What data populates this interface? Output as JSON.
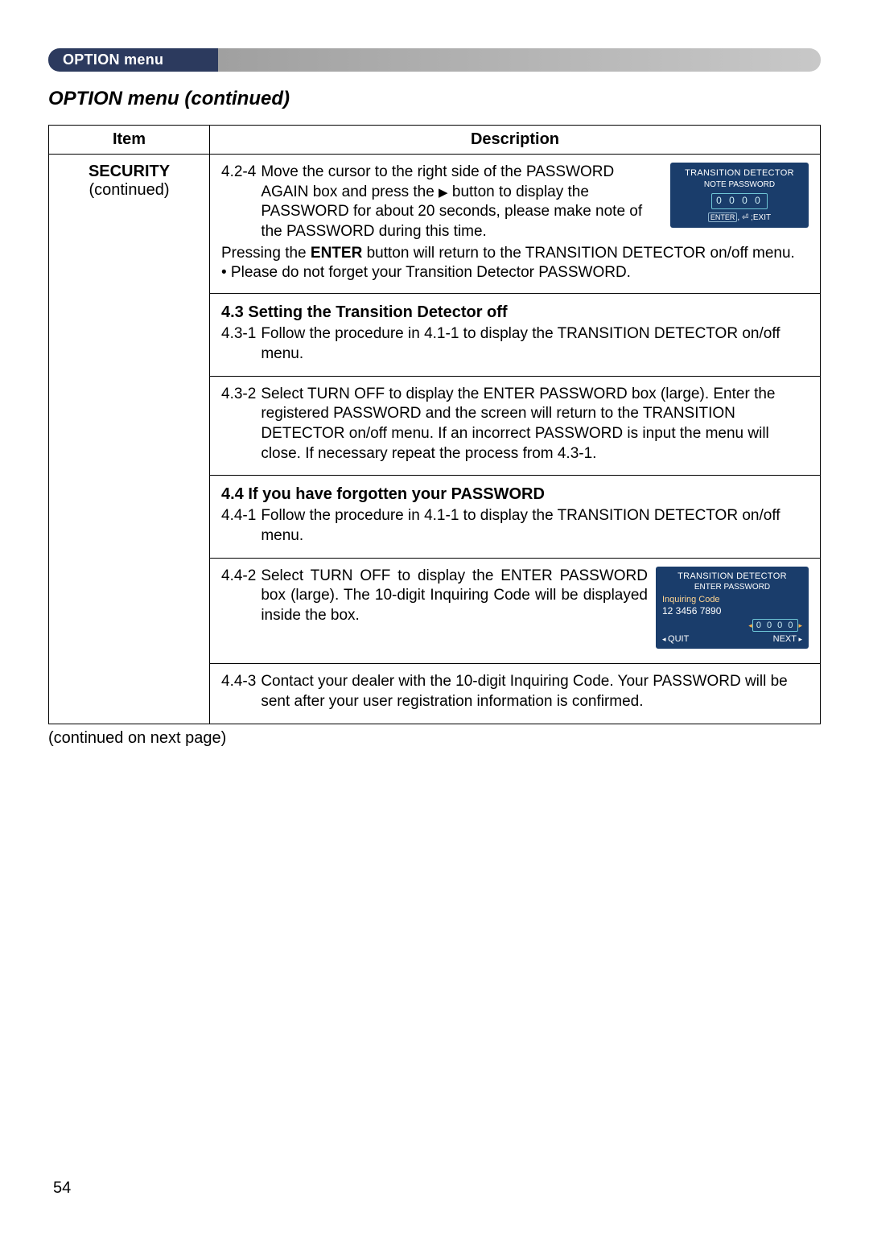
{
  "banner": {
    "label": "OPTION menu"
  },
  "section_title": "OPTION menu (continued)",
  "table": {
    "headers": {
      "item": "Item",
      "description": "Description"
    },
    "item": {
      "title": "SECURITY",
      "subtitle": "(continued)"
    }
  },
  "seg1": {
    "num": "4.2-4",
    "line1": "Move the cursor to the right side of the PASSWORD AGAIN box and press the ",
    "tri": "▶",
    "line1b": " button to display the PASSWORD for about 20 seconds, please make note of the PASSWORD during this time.",
    "line2a": "Pressing the ",
    "enter": "ENTER",
    "line2b": " button will return to the TRANSITION DETECTOR on/off menu.",
    "bullet": "• Please do not forget your Transition Detector PASSWORD.",
    "osd": {
      "title1": "TRANSITION DETECTOR",
      "title2": "NOTE PASSWORD",
      "digits": "0 0 0 0",
      "exit_btn": "ENTER",
      "exit_rest": ", ⏎ ;EXIT"
    }
  },
  "seg2": {
    "heading": "4.3 Setting the Transition Detector off",
    "num": "4.3-1",
    "body": "Follow the procedure in 4.1-1 to display the TRANSITION DETECTOR on/off menu."
  },
  "seg3": {
    "num": "4.3-2",
    "body": "Select TURN OFF to display the ENTER PASSWORD box (large). Enter the registered PASSWORD and the screen will return to the TRANSITION DETECTOR on/off menu. If an incorrect PASSWORD is input the menu will close. If necessary repeat the process from 4.3-1."
  },
  "seg4": {
    "heading": "4.4 If you have forgotten your PASSWORD",
    "num": "4.4-1",
    "body": "Follow the procedure in 4.1-1 to display the TRANSITION DETECTOR on/off menu."
  },
  "seg5": {
    "num": "4.4-2",
    "body": "Select TURN OFF to display the ENTER PASSWORD box (large). The 10-digit Inquiring Code will be displayed inside the box.",
    "osd": {
      "title1": "TRANSITION DETECTOR",
      "title2": "ENTER PASSWORD",
      "inq_label": "Inquiring Code",
      "inq_num": "12 3456 7890",
      "digits": "0 0 0 0",
      "quit": "QUIT",
      "next": "NEXT"
    }
  },
  "seg6": {
    "num": "4.4-3",
    "body": "Contact your dealer with the 10-digit Inquiring Code. Your PASSWORD will be sent after your user registration information is confirmed."
  },
  "continued_note": "(continued on next page)",
  "page_number": "54"
}
